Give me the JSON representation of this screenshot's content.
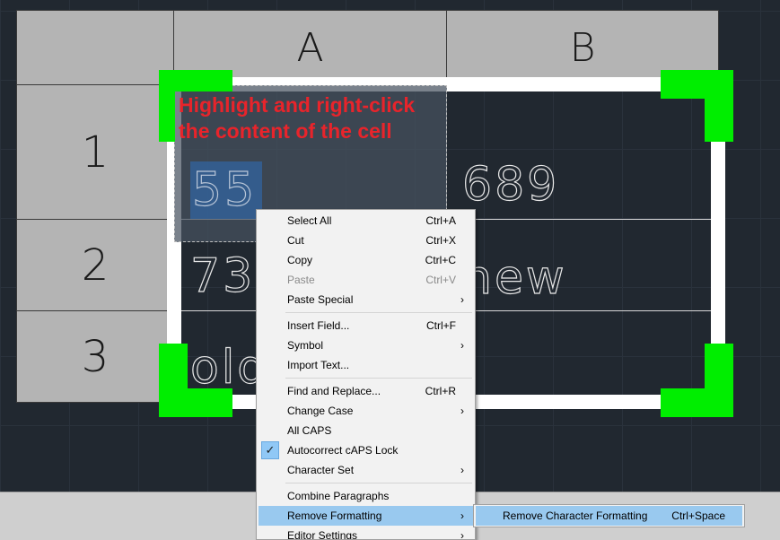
{
  "table": {
    "columns": [
      "A",
      "B"
    ],
    "rows": [
      "1",
      "2",
      "3"
    ],
    "cells": {
      "a1": "55",
      "b1": "689",
      "a2": "73",
      "b2": "new",
      "a3": "old"
    }
  },
  "annotation": {
    "line1": "Highlight and right-click",
    "line2": "the content of the cell"
  },
  "context_menu": {
    "items": [
      {
        "label": "Select All",
        "shortcut": "Ctrl+A"
      },
      {
        "label": "Cut",
        "shortcut": "Ctrl+X"
      },
      {
        "label": "Copy",
        "shortcut": "Ctrl+C"
      },
      {
        "label": "Paste",
        "shortcut": "Ctrl+V",
        "disabled": true
      },
      {
        "label": "Paste Special",
        "submenu": true
      },
      {
        "label": "Insert Field...",
        "shortcut": "Ctrl+F"
      },
      {
        "label": "Symbol",
        "submenu": true
      },
      {
        "label": "Import Text..."
      },
      {
        "label": "Find and Replace...",
        "shortcut": "Ctrl+R"
      },
      {
        "label": "Change Case",
        "submenu": true
      },
      {
        "label": "All CAPS"
      },
      {
        "label": "Autocorrect cAPS Lock",
        "checked": true
      },
      {
        "label": "Character Set",
        "submenu": true
      },
      {
        "label": "Combine Paragraphs"
      },
      {
        "label": "Remove Formatting",
        "submenu": true,
        "highlighted": true
      },
      {
        "label": "Editor Settings",
        "submenu": true
      }
    ],
    "arrow_glyph": "›",
    "check_glyph": "✓"
  },
  "submenu": {
    "label": "Remove Character Formatting",
    "shortcut": "Ctrl+Space"
  },
  "colors": {
    "annotation": "#e8242b",
    "grips": "#00ee00",
    "menu_highlight": "#99c9ef",
    "canvas": "#212830"
  }
}
